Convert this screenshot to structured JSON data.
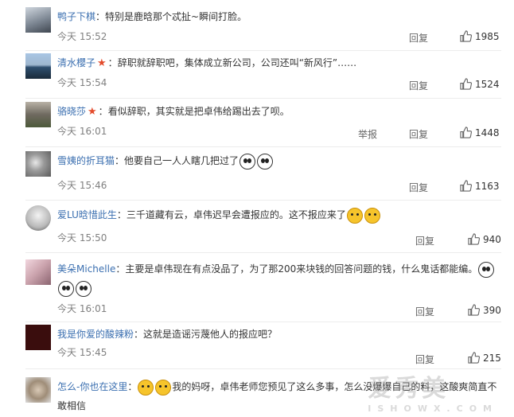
{
  "comments": [
    {
      "user": "鸭子下棋",
      "star": false,
      "text": "特别是鹿晗那个忒扯~瞬间打脸。",
      "emoji_count": 0,
      "time": "今天 15:52",
      "reply": "回复",
      "report": "",
      "likes": "1985"
    },
    {
      "user": "清水櫻子",
      "star": true,
      "text": "辞职就辞职吧，集体成立新公司，公司还叫“新风行”……",
      "emoji_count": 0,
      "time": "今天 15:54",
      "reply": "回复",
      "report": "",
      "likes": "1524"
    },
    {
      "user": "骆晓莎",
      "star": true,
      "text": "看似辞职，其实就是把卓伟给踢出去了呗。",
      "emoji_count": 0,
      "time": "今天 16:01",
      "reply": "回复",
      "report": "举报",
      "likes": "1448"
    },
    {
      "user": "雪姨的折耳猫",
      "star": false,
      "text": "他要自己一人人瞎几把过了",
      "emoji_count": 2,
      "time": "今天 15:46",
      "reply": "回复",
      "report": "",
      "likes": "1163"
    },
    {
      "user": "爱LU晗惜此生",
      "star": false,
      "text": "三千道藏有云，卓伟迟早会遭报应的。这不报应来了",
      "emoji_count": 2,
      "time": "今天 15:50",
      "reply": "回复",
      "report": "",
      "likes": "940"
    },
    {
      "user": "美朵Michelle",
      "star": false,
      "text": "主要是卓伟现在有点没品了，为了那200来块钱的回答问题的钱，什么鬼话都能编。",
      "emoji_count": 3,
      "time": "今天 16:01",
      "reply": "回复",
      "report": "",
      "likes": "390"
    },
    {
      "user": "我是你爱的酸辣粉",
      "star": false,
      "text": "这就是造谣污蔑他人的报应吧？",
      "emoji_count": 0,
      "time": "今天 15:45",
      "reply": "回复",
      "report": "",
      "likes": "215"
    },
    {
      "user": "怎么-你也在这里",
      "star": false,
      "text": "我的妈呀，卓伟老师您预见了这么多事，怎么没爆爆自己的料，这酸爽简直不敢相信",
      "emoji_count": 2,
      "time": "",
      "reply": "",
      "report": "",
      "likes": ""
    }
  ],
  "colors": {
    "username": "#3b6fb0",
    "star": "#e34b2b",
    "time": "#808080"
  },
  "icons": {
    "like": "thumbs-up-icon",
    "star": "red-star-icon"
  },
  "watermark": {
    "main": "爱秀美",
    "sub": "ISHOWX.COM"
  }
}
